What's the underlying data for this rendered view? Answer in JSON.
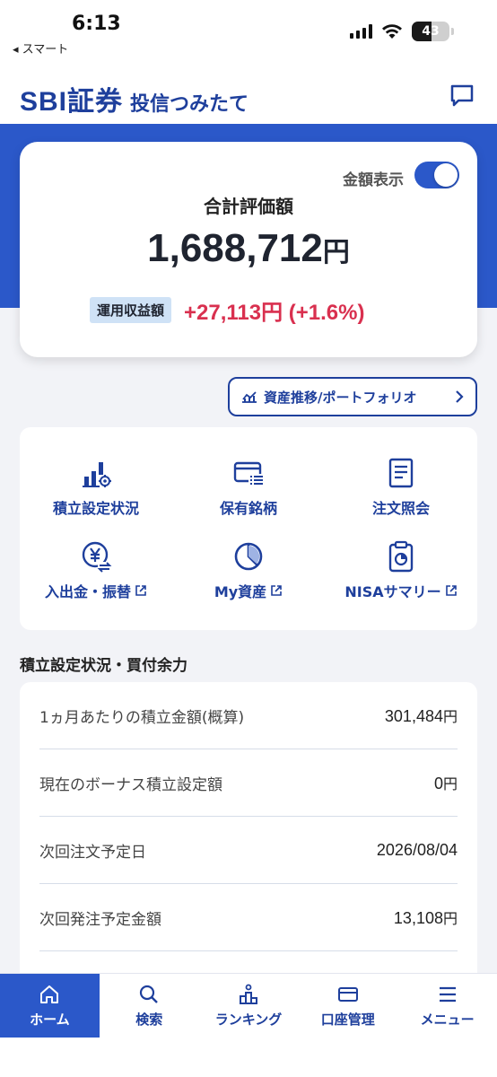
{
  "status_bar": {
    "time": "6:13",
    "back_app": "◂ スマート",
    "battery": "43"
  },
  "header": {
    "brand": "SBI証券",
    "subtitle": "投信つみたて"
  },
  "summary": {
    "toggle_label": "金額表示",
    "toggle_on": true,
    "total_label": "合計評価額",
    "total_value": "1,688,712",
    "total_unit": "円",
    "gain_label": "運用収益額",
    "gain_value": "+27,113円 (+1.6%)"
  },
  "portfolio_button": {
    "label": "資産推移/ポートフォリオ"
  },
  "menu": [
    {
      "label": "積立設定状況",
      "icon": "bar-chart-gear-icon",
      "external": false
    },
    {
      "label": "保有銘柄",
      "icon": "card-list-icon",
      "external": false
    },
    {
      "label": "注文照会",
      "icon": "document-icon",
      "external": false
    },
    {
      "label": "入出金・振替",
      "icon": "yen-transfer-icon",
      "external": true
    },
    {
      "label": "My資産",
      "icon": "pie-chart-icon",
      "external": true
    },
    {
      "label": "NISAサマリー",
      "icon": "clipboard-chart-icon",
      "external": true
    }
  ],
  "section": {
    "title": "積立設定状況・買付余力",
    "rows": [
      {
        "label": "1ヵ月あたりの積立金額(概算)",
        "value": "301,484",
        "unit": "円"
      },
      {
        "label": "現在のボーナス積立設定額",
        "value": "0",
        "unit": "円"
      },
      {
        "label": "次回注文予定日",
        "value": "2026/08/04",
        "unit": ""
      },
      {
        "label": "次回発注予定金額",
        "value": "13,108",
        "unit": "円"
      }
    ]
  },
  "bottom_nav": [
    {
      "label": "ホーム",
      "icon": "home-icon",
      "active": true
    },
    {
      "label": "検索",
      "icon": "search-icon",
      "active": false
    },
    {
      "label": "ランキング",
      "icon": "ranking-icon",
      "active": false
    },
    {
      "label": "口座管理",
      "icon": "card-icon",
      "active": false
    },
    {
      "label": "メニュー",
      "icon": "menu-icon",
      "active": false
    }
  ],
  "colors": {
    "brand": "#1e3f9c",
    "accent": "#2b58c9",
    "gain": "#d9304f",
    "badge": "#cfe2f6"
  }
}
